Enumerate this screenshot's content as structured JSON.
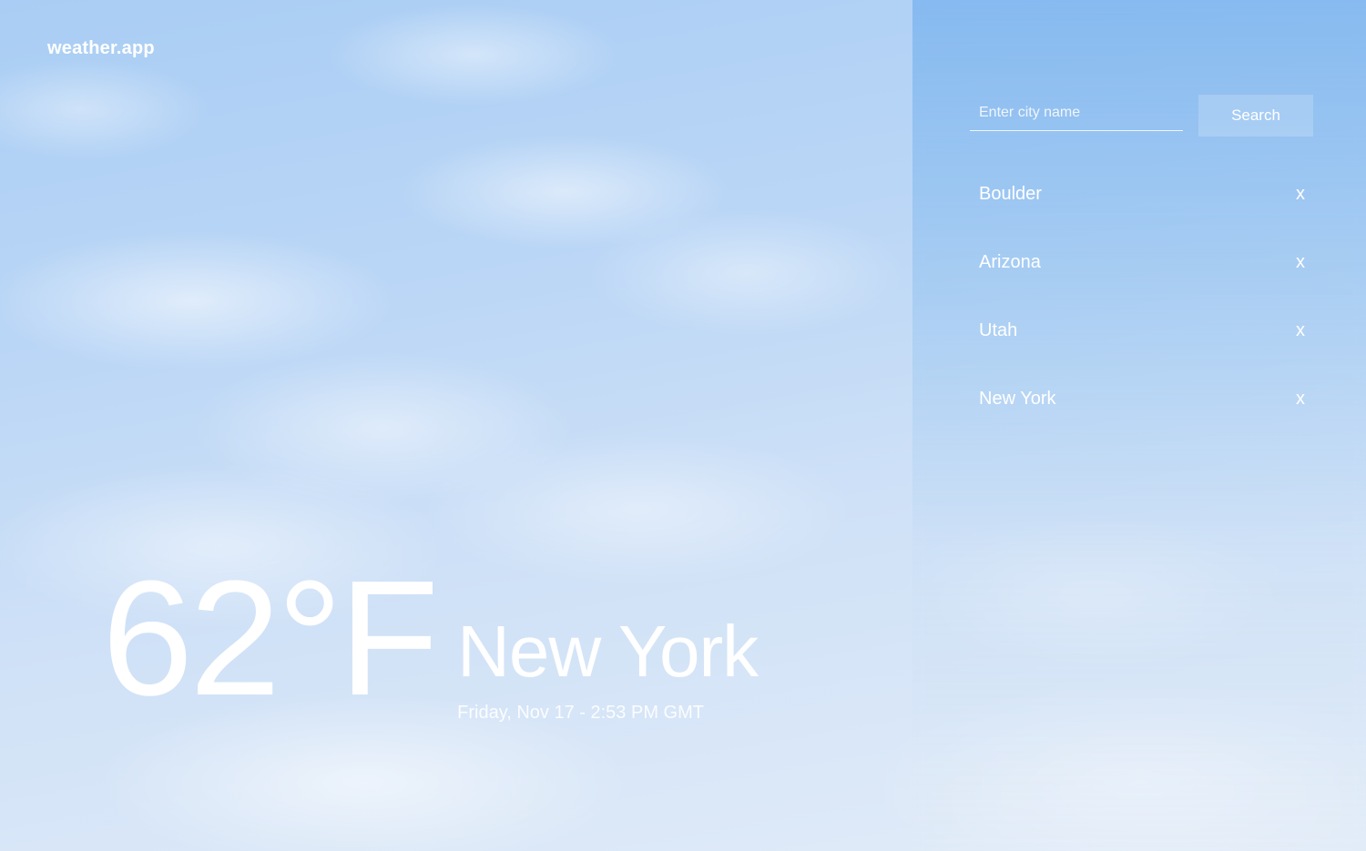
{
  "app": {
    "logo": "weather.app"
  },
  "current": {
    "temperature": "62°F",
    "city": "New York",
    "datetime": "Friday, Nov 17 - 2:53 PM GMT"
  },
  "search": {
    "placeholder": "Enter city name",
    "value": "",
    "button_label": "Search"
  },
  "saved_cities": [
    {
      "name": "Boulder",
      "remove_label": "x"
    },
    {
      "name": "Arizona",
      "remove_label": "x"
    },
    {
      "name": "Utah",
      "remove_label": "x"
    },
    {
      "name": "New York",
      "remove_label": "x"
    }
  ],
  "colors": {
    "text": "#ffffff",
    "sky_top": "#a9cdf4",
    "panel_tint": "#78b2ee"
  }
}
